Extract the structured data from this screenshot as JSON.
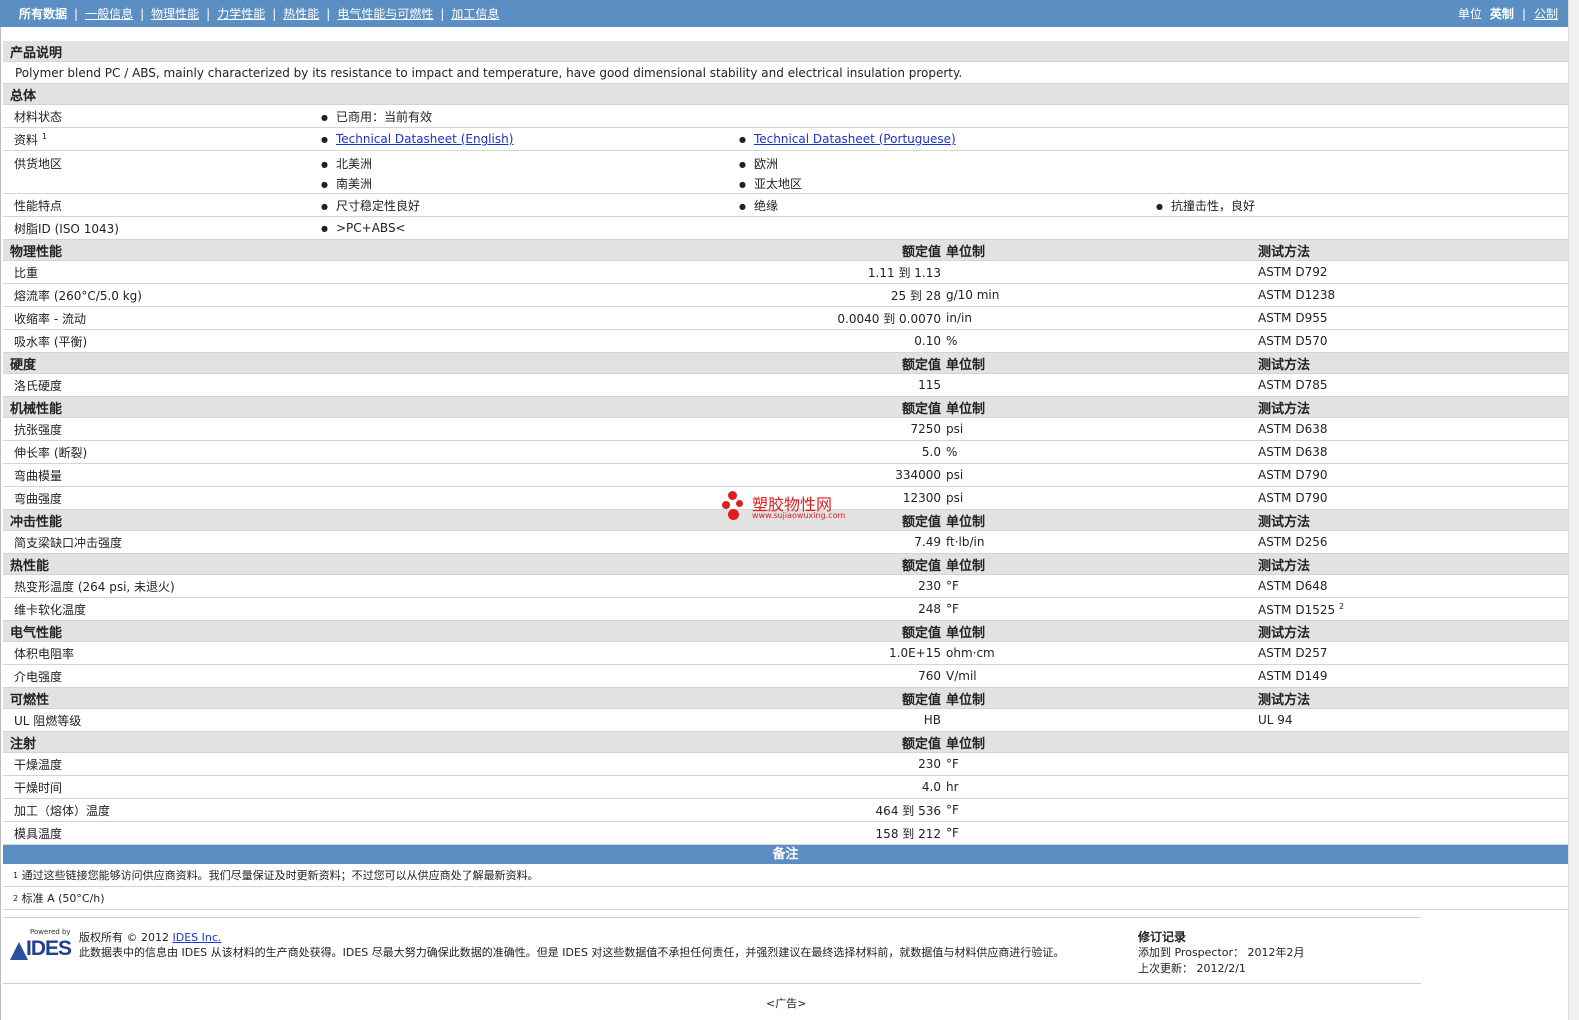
{
  "nav": {
    "tabs": [
      "所有数据",
      "一般信息",
      "物理性能",
      "力学性能",
      "热性能",
      "电气性能与可燃性",
      "加工信息"
    ],
    "units_label": "单位",
    "units_active": "英制",
    "units_other": "公制"
  },
  "product": {
    "section_title": "产品说明",
    "description": "Polymer blend PC / ABS, mainly characterized by its resistance to impact and temperature, have good dimensional stability and electrical insulation property."
  },
  "general": {
    "section_title": "总体",
    "status_label": "材料状态",
    "status_value": "已商用：当前有效",
    "docs_label": "资料",
    "docs_sup": "1",
    "doc1": "Technical Datasheet (English)",
    "doc2": "Technical Datasheet (Portuguese)",
    "supply_label": "供货地区",
    "supply": [
      "北美洲",
      "欧洲",
      "南美洲",
      "亚太地区"
    ],
    "features_label": "性能特点",
    "features": [
      "尺寸稳定性良好",
      "绝缘",
      "抗撞击性，良好"
    ],
    "resin_label": "树脂ID (ISO 1043)",
    "resin_value": ">PC+ABS<"
  },
  "headers": {
    "value": "额定值",
    "unit": "单位制",
    "test": "测试方法"
  },
  "sections": {
    "physical": {
      "title": "物理性能",
      "rows": [
        {
          "name": "比重",
          "value": "1.11 到  1.13",
          "unit": "",
          "test": "ASTM D792"
        },
        {
          "name": "熔流率  (260°C/5.0 kg)",
          "value": "25 到  28",
          "unit": "g/10 min",
          "test": "ASTM D1238"
        },
        {
          "name": "收缩率  - 流动",
          "value": "0.0040 到  0.0070",
          "unit": "in/in",
          "test": "ASTM D955"
        },
        {
          "name": "吸水率  (平衡)",
          "value": "0.10",
          "unit": "%",
          "test": "ASTM D570"
        }
      ]
    },
    "hardness": {
      "title": "硬度",
      "rows": [
        {
          "name": "洛氏硬度",
          "value": "115",
          "unit": "",
          "test": "ASTM D785"
        }
      ]
    },
    "mechanical": {
      "title": "机械性能",
      "rows": [
        {
          "name": "抗张强度",
          "value": "7250",
          "unit": "psi",
          "test": "ASTM D638"
        },
        {
          "name": "伸长率  (断裂)",
          "value": "5.0",
          "unit": "%",
          "test": "ASTM D638"
        },
        {
          "name": "弯曲模量",
          "value": "334000",
          "unit": "psi",
          "test": "ASTM D790"
        },
        {
          "name": "弯曲强度",
          "value": "12300",
          "unit": "psi",
          "test": "ASTM D790"
        }
      ]
    },
    "impact": {
      "title": "冲击性能",
      "rows": [
        {
          "name": "简支梁缺口冲击强度",
          "value": "7.49",
          "unit": "ft·lb/in",
          "test": "ASTM D256"
        }
      ]
    },
    "thermal": {
      "title": "热性能",
      "rows": [
        {
          "name": "热变形温度  (264 psi, 未退火)",
          "value": "230",
          "unit": "°F",
          "test": "ASTM D648"
        },
        {
          "name": "维卡软化温度",
          "value": "248",
          "unit": "°F",
          "test": "ASTM D1525",
          "test_sup": "2"
        }
      ]
    },
    "electrical": {
      "title": "电气性能",
      "rows": [
        {
          "name": "体积电阻率",
          "value": "1.0E+15",
          "unit": "ohm·cm",
          "test": "ASTM D257"
        },
        {
          "name": "介电强度",
          "value": "760",
          "unit": "V/mil",
          "test": "ASTM D149"
        }
      ]
    },
    "flammability": {
      "title": "可燃性",
      "rows": [
        {
          "name": "UL 阻燃等级",
          "value": "HB",
          "unit": "",
          "test": "UL 94"
        }
      ]
    },
    "injection": {
      "title": "注射",
      "rows": [
        {
          "name": "干燥温度",
          "value": "230",
          "unit": "°F",
          "test": ""
        },
        {
          "name": "干燥时间",
          "value": "4.0",
          "unit": "hr",
          "test": ""
        },
        {
          "name": "加工（熔体）温度",
          "value": "464 到  536",
          "unit": "°F",
          "test": ""
        },
        {
          "name": "模具温度",
          "value": "158 到  212",
          "unit": "°F",
          "test": ""
        }
      ]
    }
  },
  "notes": {
    "title": "备注",
    "note1_sup": "1",
    "note1": "通过这些链接您能够访问供应商资料。我们尽量保证及时更新资料；不过您可以从供应商处了解最新资料。",
    "note2_sup": "2",
    "note2": "标准  A (50°C/h)"
  },
  "footer": {
    "logo_small": "Powered by",
    "logo_text": "IDES",
    "copyright_prefix": "版权所有  © 2012",
    "copyright_link": "IDES Inc.",
    "disclaimer": "此数据表中的信息由  IDES 从该材料的生产商处获得。IDES 尽最大努力确保此数据的准确性。但是  IDES 对这些数据值不承担任何责任，并强烈建议在最终选择材料前，就数据值与材料供应商进行验证。",
    "rev_title": "修订记录",
    "rev_added": "添加到  Prospector：  2012年2月",
    "rev_updated": "上次更新：  2012/2/1",
    "ad": "<广告>"
  },
  "watermark": {
    "cn": "塑胶物性网",
    "url": "www.sujiaowuxing.com"
  },
  "colors": {
    "nav_bg": "#5b8fc4",
    "section_bg": "#e2e2e2",
    "link": "#1a33cc",
    "watermark": "#e01e1e"
  }
}
